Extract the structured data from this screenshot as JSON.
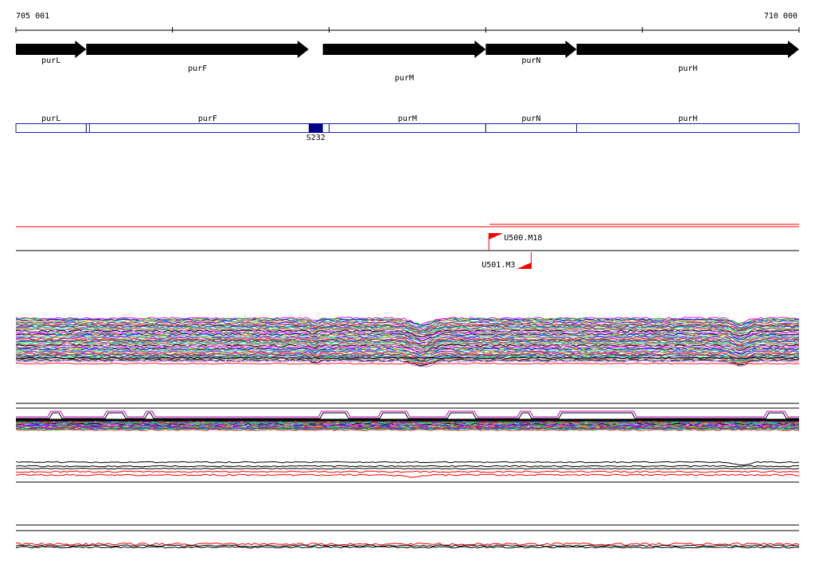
{
  "ruler": {
    "start_label": "705 001",
    "end_label": "710 000",
    "start": 705001,
    "end": 710000,
    "tick_interval": 1000
  },
  "genes": [
    {
      "name": "purL",
      "start": 705001,
      "end": 705450
    },
    {
      "name": "purF",
      "start": 705450,
      "end": 706870
    },
    {
      "name": "purM",
      "start": 706960,
      "end": 708000
    },
    {
      "name": "purN",
      "start": 708000,
      "end": 708580
    },
    {
      "name": "purH",
      "start": 708580,
      "end": 710000
    }
  ],
  "regions": [
    {
      "name": "purL",
      "start": 705001,
      "end": 705450
    },
    {
      "name": "purF",
      "start": 705450,
      "end": 707000
    },
    {
      "name": "purM",
      "start": 707000,
      "end": 708000
    },
    {
      "name": "purN",
      "start": 708000,
      "end": 708580
    },
    {
      "name": "purH",
      "start": 708580,
      "end": 710000
    }
  ],
  "feature": {
    "name": "S232",
    "start": 706870,
    "end": 706960
  },
  "markers": [
    {
      "name": "U500.M18",
      "position": 708020,
      "strand": "+"
    },
    {
      "name": "U501.M3",
      "position": 708290,
      "strand": "-"
    }
  ],
  "colors": {
    "gene_arrow": "#000000",
    "region_outline": "#1c1ca8",
    "feature_fill": "#00008b",
    "marker": "#ff0000",
    "line": "#000000"
  }
}
